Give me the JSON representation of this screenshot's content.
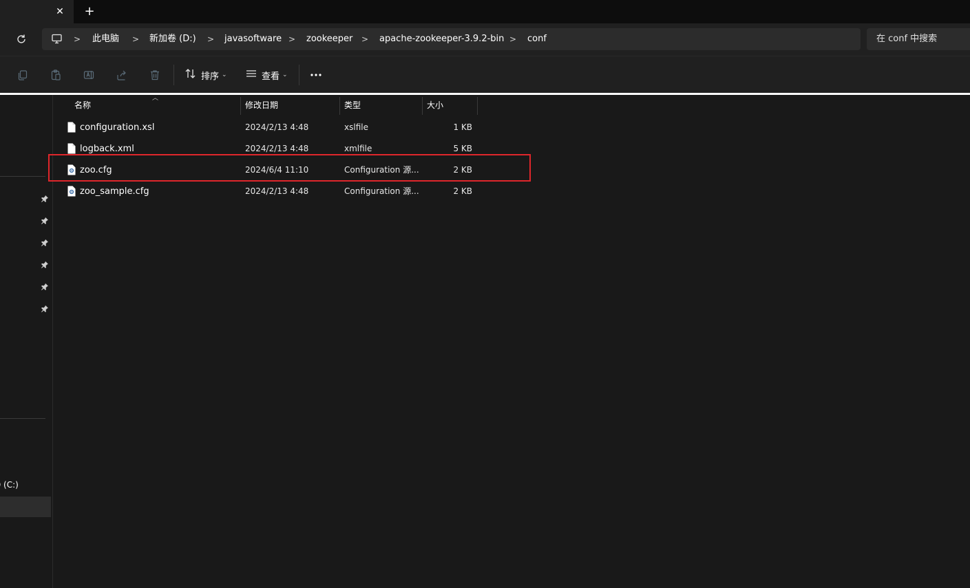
{
  "tabbar": {
    "close_glyph": "✕",
    "new_tab_glyph": "+"
  },
  "address": {
    "refresh_icon": "refresh-icon",
    "pc_icon": "computer-icon",
    "crumbs": [
      "此电脑",
      "新加卷 (D:)",
      "javasoftware",
      "zookeeper",
      "apache-zookeeper-3.9.2-bin",
      "conf"
    ],
    "separator": ">"
  },
  "search": {
    "placeholder": "在 conf 中搜索"
  },
  "commandbar": {
    "icons": [
      "copy-icon",
      "paste-icon",
      "rename-icon",
      "share-icon",
      "delete-icon"
    ],
    "sort_label": "排序",
    "view_label": "查看",
    "more_label": "•••"
  },
  "navpane": {
    "drive_label": "D (C:)"
  },
  "columns": {
    "name": "名称",
    "modified": "修改日期",
    "type": "类型",
    "size": "大小"
  },
  "files": [
    {
      "name": "configuration.xsl",
      "modified": "2024/2/13 4:48",
      "type": "xslfile",
      "size": "1 KB",
      "icon": "file-icon"
    },
    {
      "name": "logback.xml",
      "modified": "2024/2/13 4:48",
      "type": "xmlfile",
      "size": "5 KB",
      "icon": "file-icon"
    },
    {
      "name": "zoo.cfg",
      "modified": "2024/6/4 11:10",
      "type": "Configuration 源...",
      "size": "2 KB",
      "icon": "config-file-icon"
    },
    {
      "name": "zoo_sample.cfg",
      "modified": "2024/2/13 4:48",
      "type": "Configuration 源...",
      "size": "2 KB",
      "icon": "config-file-icon"
    }
  ],
  "colors": {
    "highlight_box": "#e0262b",
    "background": "#191919",
    "toolbar": "#202020"
  }
}
